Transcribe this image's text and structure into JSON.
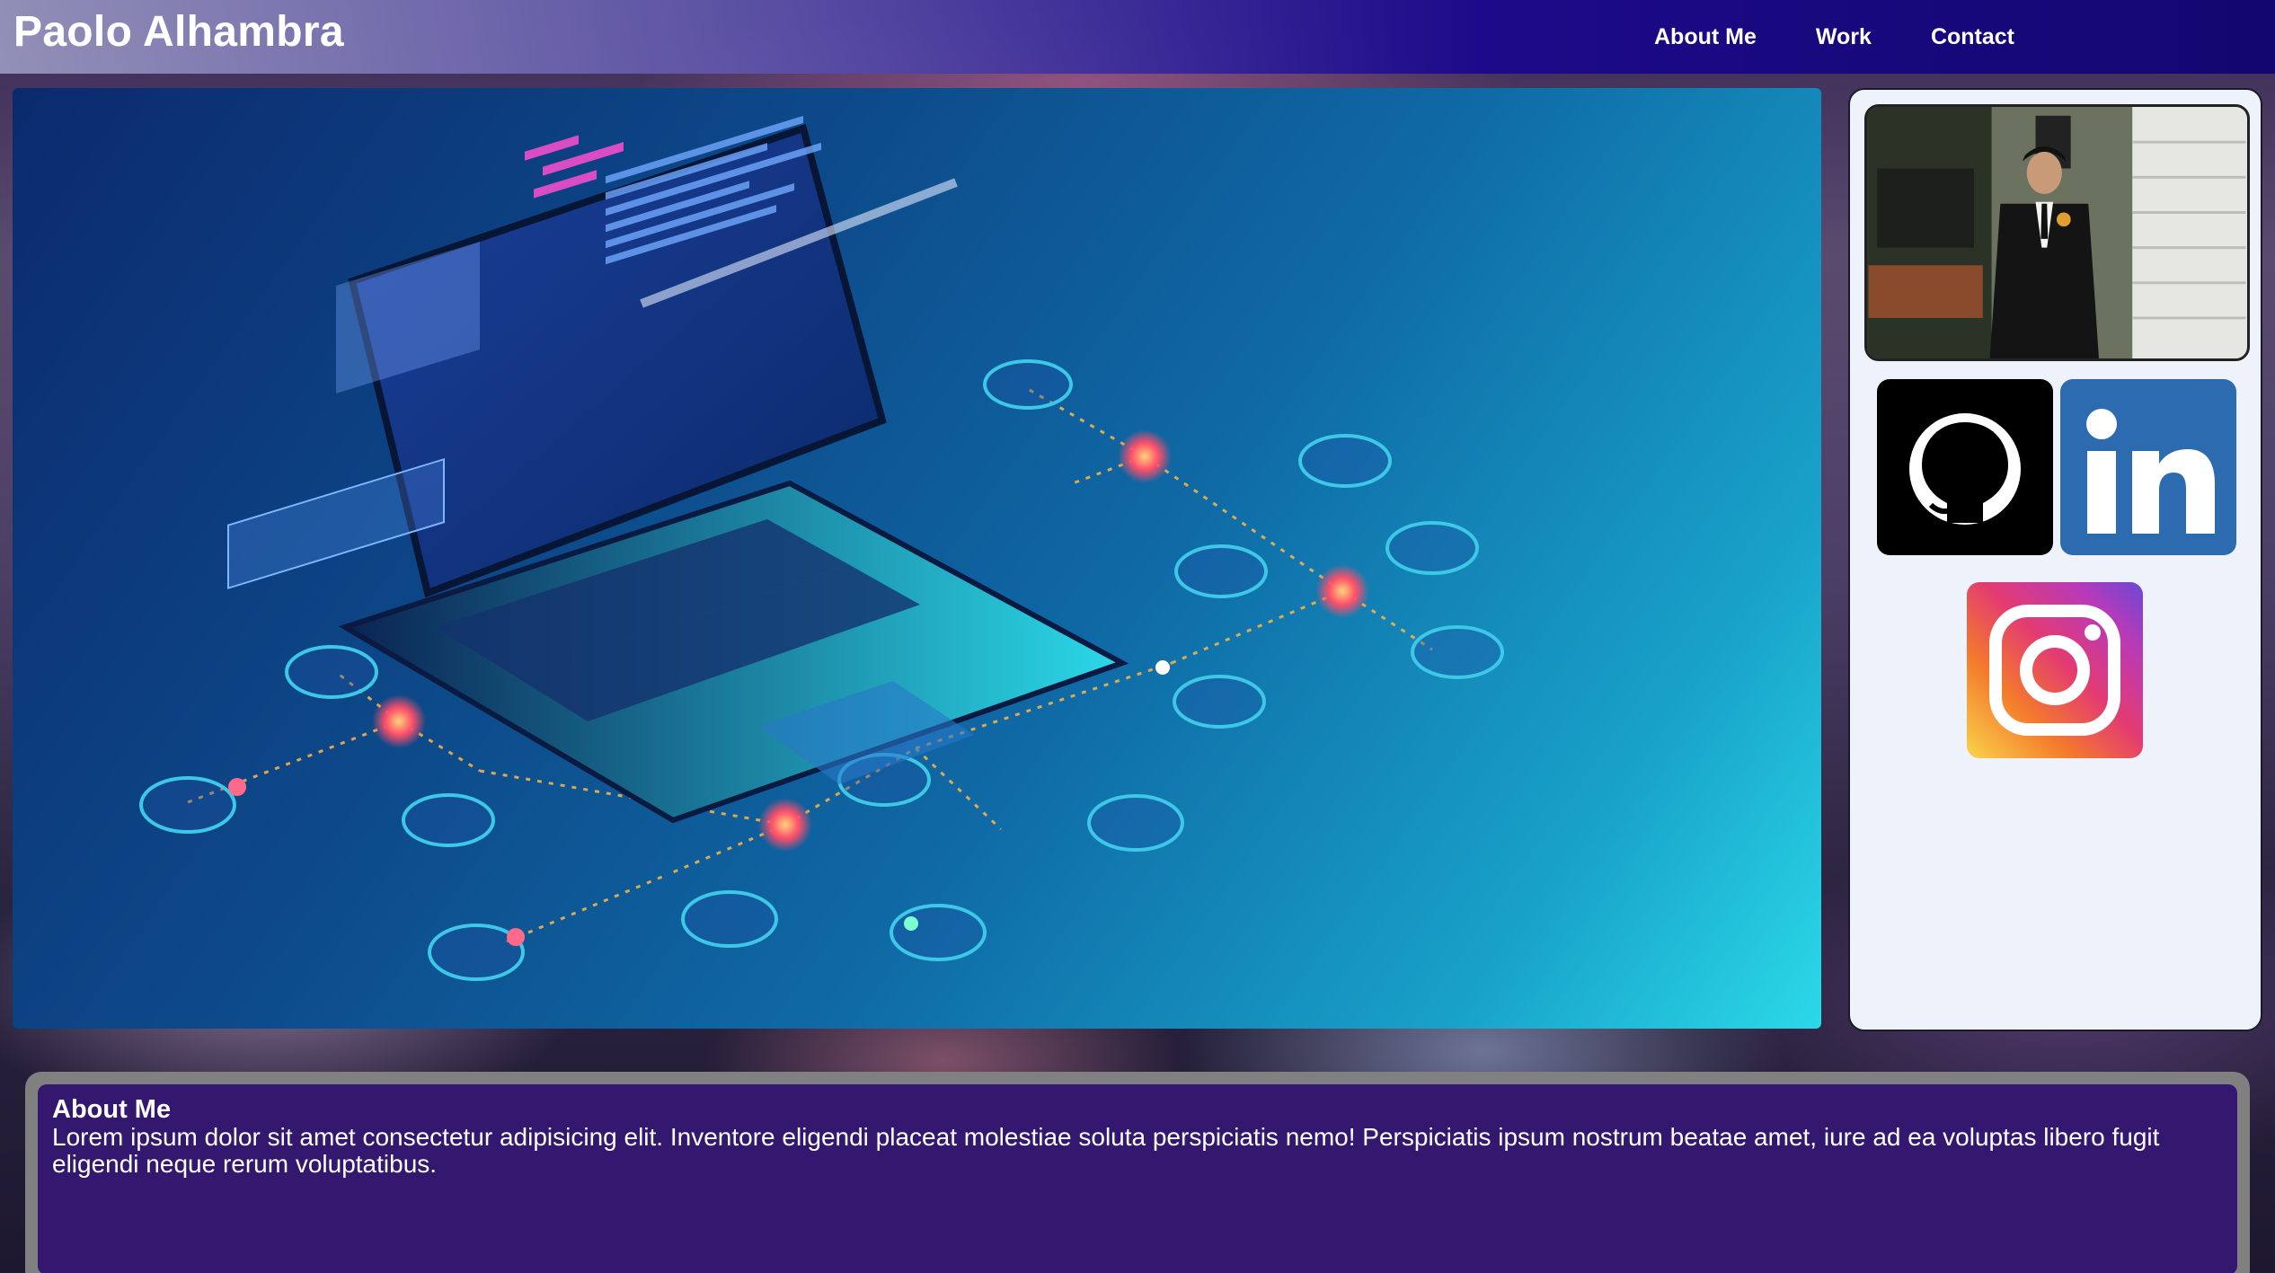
{
  "header": {
    "brand": "Paolo Alhambra",
    "nav": [
      "About Me",
      "Work",
      "Contact"
    ]
  },
  "about": {
    "title": "About Me",
    "text": "Lorem ipsum dolor sit amet consectetur adipisicing elit. Inventore eligendi placeat molestiae soluta perspiciatis nemo! Perspiciatis ipsum nostrum beatae amet, iure ad ea voluptas libero fugit eligendi neque rerum voluptatibus."
  },
  "icons": {
    "github": "github-icon",
    "linkedin": "linkedin-icon",
    "linkedin_glyph": "in",
    "instagram": "instagram-icon"
  },
  "colors": {
    "nav_accent": "#120770",
    "about_bg": "#34186f",
    "sidebar_bg": "#eef3fb",
    "linkedin_blue": "#2d6bb0"
  }
}
